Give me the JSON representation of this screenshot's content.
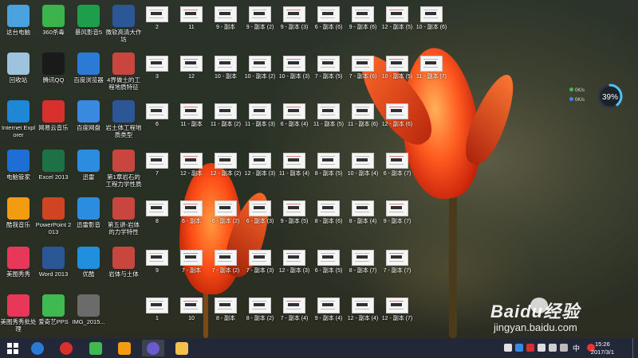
{
  "desktop_icons": [
    {
      "label": "这台电脑",
      "icon": "computer-icon",
      "color": "#4aa3df"
    },
    {
      "label": "360杀毒",
      "icon": "360-antivirus-icon",
      "color": "#3cb44b"
    },
    {
      "label": "暴风影音5",
      "icon": "storm-player-icon",
      "color": "#1e9e4a"
    },
    {
      "label": "微软高清大作坊",
      "icon": "word-doc-icon",
      "color": "#2b5797"
    },
    {
      "label": "回收站",
      "icon": "recycle-bin-icon",
      "color": "#9ec3dc"
    },
    {
      "label": "腾讯QQ",
      "icon": "qq-icon",
      "color": "#1a1a1a"
    },
    {
      "label": "百度浏览器",
      "icon": "baidu-browser-icon",
      "color": "#2a7ad6"
    },
    {
      "label": "4界做土的工程地质特征",
      "icon": "ppt-file-icon",
      "color": "#c8463d"
    },
    {
      "label": "Internet Explorer",
      "icon": "ie-icon",
      "color": "#1e88d6"
    },
    {
      "label": "网易云音乐",
      "icon": "netease-music-icon",
      "color": "#d8302c"
    },
    {
      "label": "百度网盘",
      "icon": "baidu-netdisk-icon",
      "color": "#3a89e0"
    },
    {
      "label": "岩土体工程地质类型",
      "icon": "word-doc-icon",
      "color": "#2b5797"
    },
    {
      "label": "电脑管家",
      "icon": "pc-manager-icon",
      "color": "#1f6ed6"
    },
    {
      "label": "Excel 2013",
      "icon": "excel-icon",
      "color": "#1e7145"
    },
    {
      "label": "迅雷",
      "icon": "thunder-icon",
      "color": "#2b8ce0"
    },
    {
      "label": "第1章岩石的工程力学性质",
      "icon": "ppt-file-icon",
      "color": "#c8463d"
    },
    {
      "label": "酷我音乐",
      "icon": "kuwo-music-icon",
      "color": "#f39c12"
    },
    {
      "label": "PowerPoint 2013",
      "icon": "powerpoint-icon",
      "color": "#d04423"
    },
    {
      "label": "迅雷影音",
      "icon": "thunder-video-icon",
      "color": "#2b8ce0"
    },
    {
      "label": "第五讲-岩体的力学特性",
      "icon": "ppt-file-icon",
      "color": "#c8463d"
    },
    {
      "label": "美图秀秀",
      "icon": "meitu-icon",
      "color": "#e8385a"
    },
    {
      "label": "Word 2013",
      "icon": "word-icon",
      "color": "#2b5797"
    },
    {
      "label": "优酷",
      "icon": "youku-icon",
      "color": "#1f8fde"
    },
    {
      "label": "岩体与土体",
      "icon": "ppt-file-icon",
      "color": "#c8463d"
    },
    {
      "label": "美图秀秀批处理",
      "icon": "meitu-batch-icon",
      "color": "#e8385a"
    },
    {
      "label": "爱奇艺PPS",
      "icon": "iqiyi-pps-icon",
      "color": "#3fb950"
    },
    {
      "label": "IMG_2015...",
      "icon": "image-file-icon",
      "color": "#6b6b6b"
    },
    {
      "label": "爱奇艺",
      "icon": "iqiyi-icon",
      "color": "#3fb950"
    }
  ],
  "thumbnail_rows": [
    [
      "2",
      "11",
      "9 - 副本",
      "9 - 副本 (2)",
      "9 - 副本 (3)",
      "6 - 副本 (6)",
      "9 - 副本 (6)",
      "12 - 副本 (5)",
      "10 - 副本 (6)"
    ],
    [
      "3",
      "12",
      "10 - 副本",
      "10 - 副本 (2)",
      "10 - 副本 (3)",
      "7 - 副本 (5)",
      "7 - 副本 (6)",
      "10 - 副本 (5)",
      "11 - 副本 (7)"
    ],
    [
      "6",
      "11 - 副本",
      "11 - 副本 (2)",
      "11 - 副本 (3)",
      "6 - 副本 (4)",
      "11 - 副本 (5)",
      "11 - 副本 (6)",
      "12 - 副本 (6)"
    ],
    [
      "7",
      "12 - 副本",
      "12 - 副本 (2)",
      "12 - 副本 (3)",
      "11 - 副本 (4)",
      "8 - 副本 (5)",
      "10 - 副本 (4)",
      "6 - 副本 (7)"
    ],
    [
      "8",
      "6 - 副本",
      "6 - 副本 (2)",
      "6 - 副本 (3)",
      "9 - 副本 (5)",
      "8 - 副本 (6)",
      "8 - 副本 (4)",
      "9 - 副本 (7)"
    ],
    [
      "9",
      "7 - 副本",
      "7 - 副本 (2)",
      "7 - 副本 (3)",
      "12 - 副本 (3)",
      "6 - 副本 (5)",
      "8 - 副本 (7)",
      "7 - 副本 (7)"
    ],
    [
      "1",
      "10",
      "8 - 副本",
      "8 - 副本 (2)",
      "7 - 副本 (4)",
      "9 - 副本 (4)",
      "12 - 副本 (4)",
      "12 - 副本 (7)"
    ]
  ],
  "monitor": {
    "percent": "39%",
    "up": "0K/s",
    "down": "0K/s"
  },
  "watermark": {
    "brand": "Baidu经验",
    "url": "jingyan.baidu.com"
  },
  "taskbar": {
    "items": [
      {
        "icon": "windows-start-icon",
        "color": "#ffffff"
      },
      {
        "icon": "baidu-browser-icon",
        "color": "#2a7ad6"
      },
      {
        "icon": "netease-music-icon",
        "color": "#d8302c"
      },
      {
        "icon": "iqiyi-icon",
        "color": "#3fb950"
      },
      {
        "icon": "kuwo-music-icon",
        "color": "#f39c12"
      },
      {
        "icon": "settings-icon",
        "color": "#6a5acd"
      },
      {
        "icon": "file-explorer-icon",
        "color": "#f2c14e"
      }
    ],
    "tray_ime": "中",
    "time": "15:26",
    "date": "2017/3/1"
  }
}
